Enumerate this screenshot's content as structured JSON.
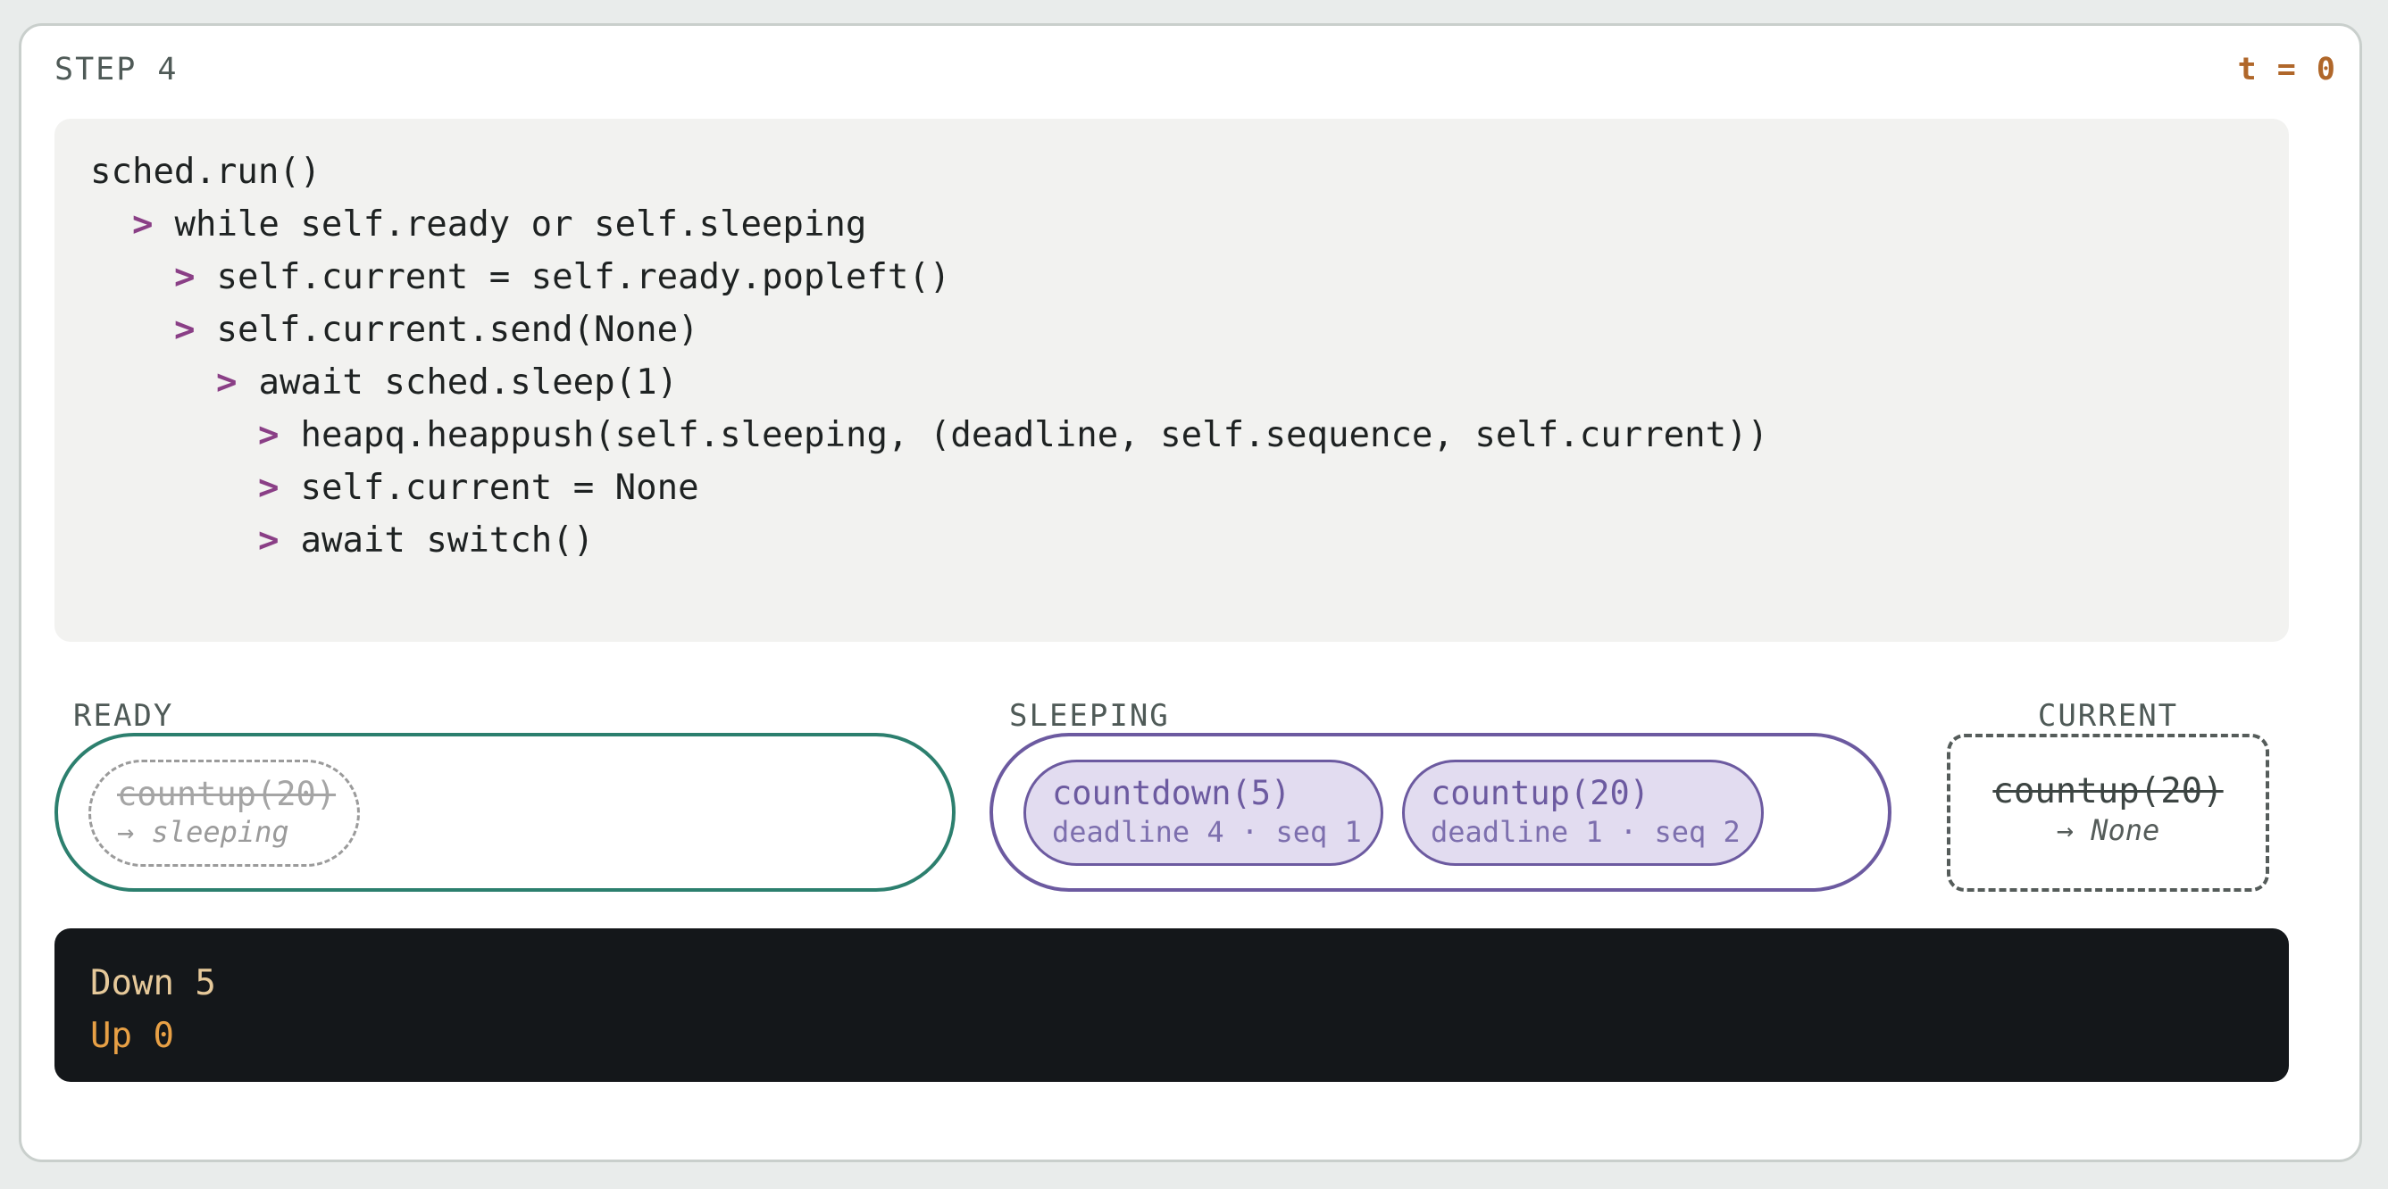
{
  "header": {
    "step": "STEP 4",
    "time": "t = 0",
    "time_color": "#b0672a"
  },
  "code": {
    "lines": [
      {
        "indent": 0,
        "arrow": "",
        "text": "sched.run()"
      },
      {
        "indent": 1,
        "arrow": ">",
        "text": "while self.ready or self.sleeping"
      },
      {
        "indent": 2,
        "arrow": ">",
        "text": "self.current = self.ready.popleft()"
      },
      {
        "indent": 2,
        "arrow": ">",
        "text": "self.current.send(None)"
      },
      {
        "indent": 3,
        "arrow": ">",
        "text": "await sched.sleep(1)"
      },
      {
        "indent": 4,
        "arrow": ">",
        "text": "heapq.heappush(self.sleeping, (deadline, self.sequence, self.current))"
      },
      {
        "indent": 4,
        "arrow": ">",
        "text": "self.current = None"
      },
      {
        "indent": 4,
        "arrow": ">",
        "text": "await switch()"
      }
    ]
  },
  "ready": {
    "label": "READY",
    "color": "#2c7f6e",
    "departing": {
      "name": "countup(20)",
      "note": "→ sleeping"
    }
  },
  "sleeping": {
    "label": "SLEEPING",
    "color": "#6c5aa0",
    "tasks": [
      {
        "name": "countdown(5)",
        "detail": "deadline 4 · seq 1"
      },
      {
        "name": "countup(20)",
        "detail": "deadline 1 · seq 2"
      }
    ]
  },
  "current": {
    "label": "CURRENT",
    "name": "countup(20)",
    "note": "→ None"
  },
  "console": {
    "lines": [
      {
        "text": "Down 5",
        "color": "#e6c99a"
      },
      {
        "text": "Up 0",
        "color": "#e8a045"
      }
    ]
  }
}
